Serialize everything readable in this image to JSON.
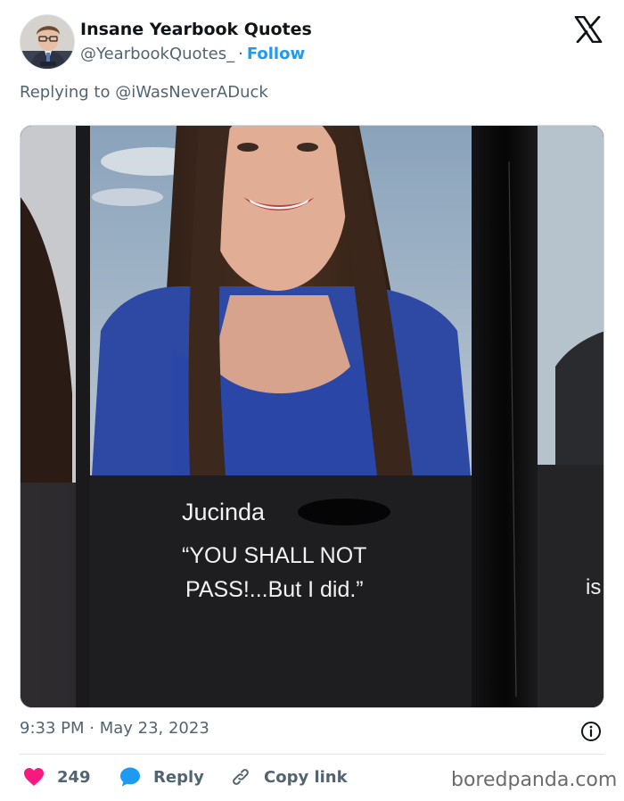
{
  "tweet": {
    "display_name": "Insane Yearbook Quotes",
    "handle": "@YearbookQuotes_",
    "separator": "·",
    "follow_label": "Follow",
    "replying_to": "Replying to @iWasNeverADuck",
    "timestamp": "9:33 PM · May 23, 2023",
    "likes_count": "249",
    "reply_label": "Reply",
    "copy_link_label": "Copy link",
    "brand": "X"
  },
  "photo": {
    "student_name": "Jucinda",
    "quote_line1": "“YOU SHALL NOT",
    "quote_line2": "PASS!...But I did.”",
    "adjacent_fragment": "is"
  },
  "watermark": "boredpanda.com",
  "colors": {
    "accent": "#1d9bf0",
    "like": "#f91880",
    "muted": "#536471"
  },
  "icons": {
    "logo": "x-logo-icon",
    "info": "info-icon",
    "like": "heart-icon",
    "reply": "speech-bubble-icon",
    "copy": "link-icon"
  }
}
